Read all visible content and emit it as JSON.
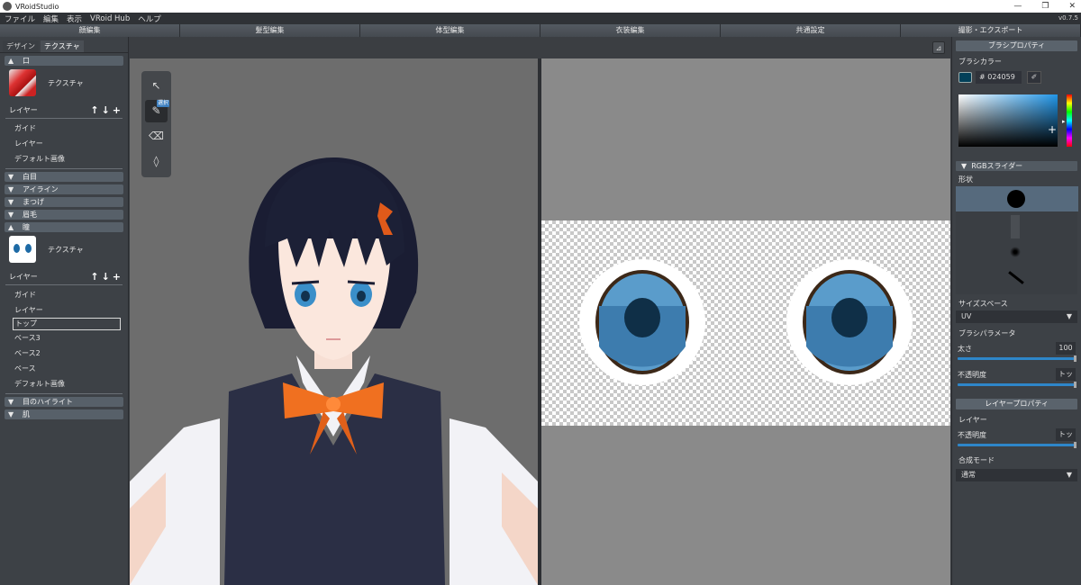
{
  "window": {
    "title": "VRoidStudio",
    "version": "v0.7.5",
    "controls": [
      "—",
      "❐",
      "✕"
    ]
  },
  "menu": [
    "ファイル",
    "編集",
    "表示",
    "VRoid Hub",
    "ヘルプ"
  ],
  "mode_tabs": [
    "顔編集",
    "髪型編集",
    "体型編集",
    "衣装編集",
    "共通設定",
    "撮影・エクスポート"
  ],
  "left": {
    "subtabs": [
      "デザイン",
      "テクスチャ"
    ],
    "mouth": {
      "header": "口",
      "texture_label": "テクスチャ",
      "layer_header": "レイヤー",
      "layers": [
        "ガイド",
        "レイヤー",
        "デフォルト画像"
      ]
    },
    "collapsed": [
      "白目",
      "アイライン",
      "まつげ",
      "眉毛"
    ],
    "eye": {
      "header": "瞳",
      "texture_label": "テクスチャ",
      "layer_header": "レイヤー",
      "layers": [
        "ガイド",
        "レイヤー",
        "トップ",
        "ベース3",
        "ベース2",
        "ベース",
        "デフォルト画像"
      ],
      "selected": "トップ"
    },
    "bottom": [
      "目のハイライト",
      "肌"
    ],
    "layer_tools": [
      "↑",
      "↓",
      "+"
    ]
  },
  "viewport": {
    "split_icon": "split-view-icon",
    "tools": [
      "cursor-icon",
      "pen-icon",
      "eraser-icon",
      "fill-icon"
    ],
    "tool_badge": "選択"
  },
  "right": {
    "brush_props_title": "ブラシプロパティ",
    "brush_color_label": "ブラシカラー",
    "hex": "# 024059",
    "color": "#024059",
    "rgb_slider": "RGBスライダー",
    "shape_label": "形状",
    "size_space_label": "サイズスペース",
    "size_space_value": "UV",
    "brush_params_label": "ブラシパラメータ",
    "thickness_label": "太さ",
    "thickness_value": "100",
    "opacity_label": "不透明度",
    "opacity_value": "トッ",
    "layer_props_title": "レイヤープロパティ",
    "layer_label": "レイヤー",
    "layer_opacity_label": "不透明度",
    "layer_opacity_value": "トッ",
    "blend_label": "合成モード",
    "blend_value": "通常"
  }
}
